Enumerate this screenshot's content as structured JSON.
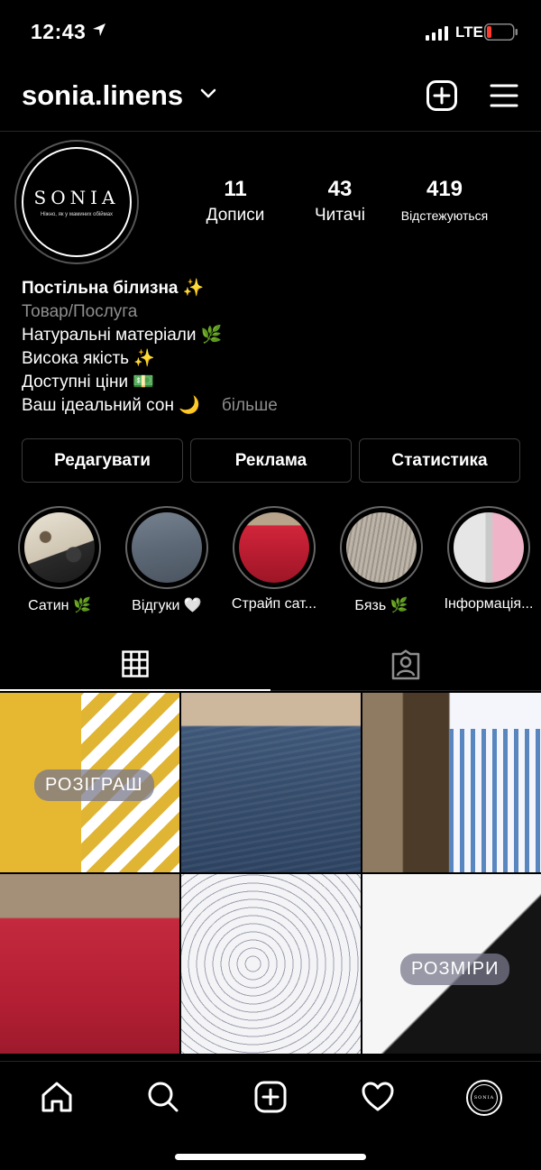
{
  "status": {
    "time": "12:43",
    "network": "LTE"
  },
  "header": {
    "username": "sonia.linens"
  },
  "profile": {
    "avatar_logo": "SONIA",
    "avatar_tagline": "Ніжно, як у маминих обіймах",
    "stats": {
      "posts": {
        "value": "11",
        "label": "Дописи"
      },
      "followers": {
        "value": "43",
        "label": "Читачі"
      },
      "following": {
        "value": "419",
        "label": "Відстежуються"
      }
    },
    "bio": {
      "name": "Постільна білизна ✨",
      "category": "Товар/Послуга",
      "lines": [
        "Натуральні матеріали 🌿",
        "Висока якість ✨",
        "Доступні ціни 💵",
        "Ваш ідеальний сон 🌙"
      ],
      "more": "більше"
    }
  },
  "buttons": {
    "edit": "Редагувати",
    "promote": "Реклама",
    "insights": "Статистика"
  },
  "highlights": [
    {
      "label": "Сатин 🌿"
    },
    {
      "label": "Відгуки 🤍"
    },
    {
      "label": "Страйп сат..."
    },
    {
      "label": "Бязь 🌿"
    },
    {
      "label": "Інформація..."
    }
  ],
  "grid": {
    "posts": [
      {
        "overlay": "РОЗІГРАШ"
      },
      {
        "overlay": ""
      },
      {
        "overlay": ""
      },
      {
        "overlay": ""
      },
      {
        "overlay": ""
      },
      {
        "overlay": "РОЗМІРИ"
      }
    ]
  },
  "nav": [
    "home-icon",
    "search-icon",
    "new-post-icon",
    "activity-heart-icon",
    "profile-avatar"
  ],
  "colors": {
    "background": "#000000",
    "text": "#ffffff",
    "secondary": "#8e8e8e",
    "border": "#3a3a3a",
    "battery_low": "#ff3b30"
  }
}
